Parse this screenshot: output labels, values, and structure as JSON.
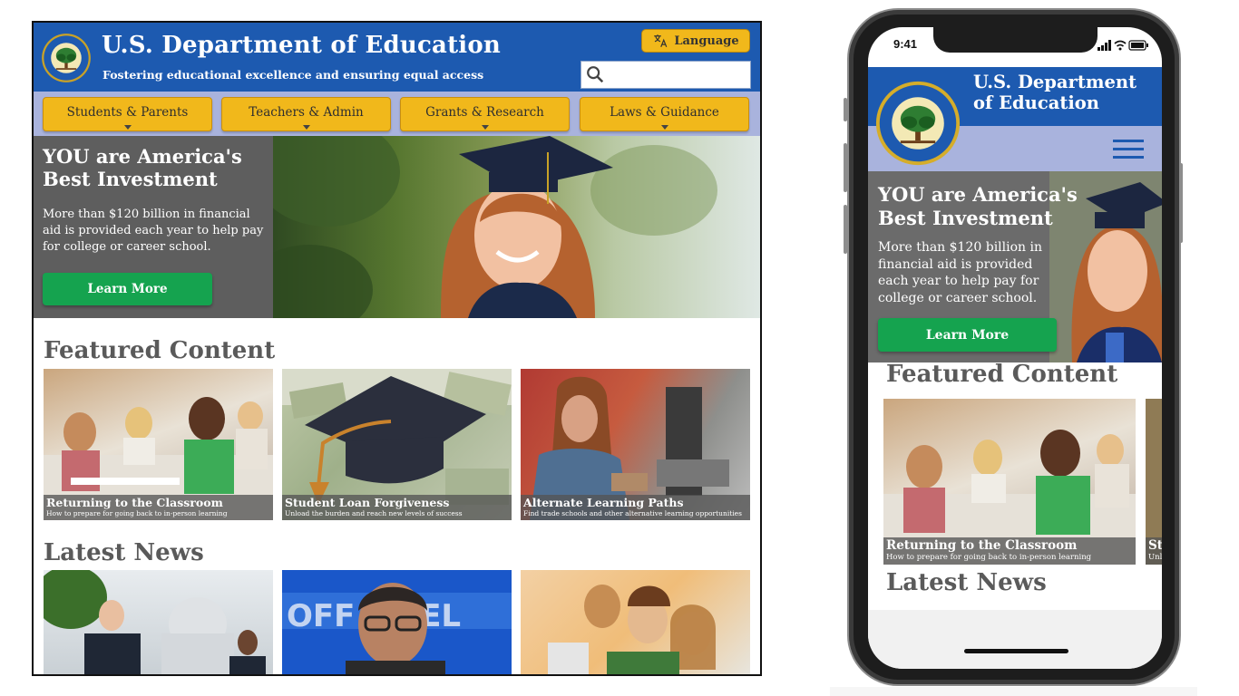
{
  "desktop": {
    "header": {
      "title": "U.S. Department of Education",
      "tagline": "Fostering educational excellence and ensuring equal access",
      "language_label": "Language",
      "search_placeholder": ""
    },
    "nav": [
      {
        "label": "Students & Parents"
      },
      {
        "label": "Teachers & Admin"
      },
      {
        "label": "Grants & Research"
      },
      {
        "label": "Laws & Guidance"
      }
    ],
    "hero": {
      "heading": "YOU are America's Best Investment",
      "body": "More than $120 billion in financial aid is provided each year to help pay for college or career school.",
      "button": "Learn More"
    },
    "featured": {
      "heading": "Featured Content",
      "cards": [
        {
          "title": "Returning to the Classroom",
          "subtitle": "How to prepare for going back to in-person learning"
        },
        {
          "title": "Student Loan Forgiveness",
          "subtitle": "Unload the burden and reach new levels of success"
        },
        {
          "title": "Alternate Learning Paths",
          "subtitle": "Find trade schools and other alternative learning opportunities"
        }
      ]
    },
    "news": {
      "heading": "Latest News"
    }
  },
  "mobile": {
    "status_time": "9:41",
    "header_title": "U.S. Department of Education",
    "hero": {
      "heading": "YOU are America's Best Investment",
      "body": "More than $120 billion in financial aid is provided each year to help pay for college or career school.",
      "button": "Learn More"
    },
    "featured_heading": "Featured Content",
    "card": {
      "title": "Returning to the Classroom",
      "subtitle": "How to prepare for going back to in-person learning"
    },
    "card2_partial": "St",
    "card2_partial_sub": "Unl",
    "news_heading": "Latest News"
  },
  "colors": {
    "brand_blue": "#1d5ab0",
    "nav_gold": "#f1b81b",
    "subnav_lavender": "#a9b3dd",
    "cta_green": "#15a34f",
    "panel_gray": "#5e5e5e",
    "heading_gray": "#5a5a5a"
  },
  "icons": [
    "education-seal-icon",
    "translate-icon",
    "search-icon",
    "caret-down-icon",
    "hamburger-menu-icon",
    "signal-icon",
    "wifi-icon",
    "battery-icon"
  ]
}
